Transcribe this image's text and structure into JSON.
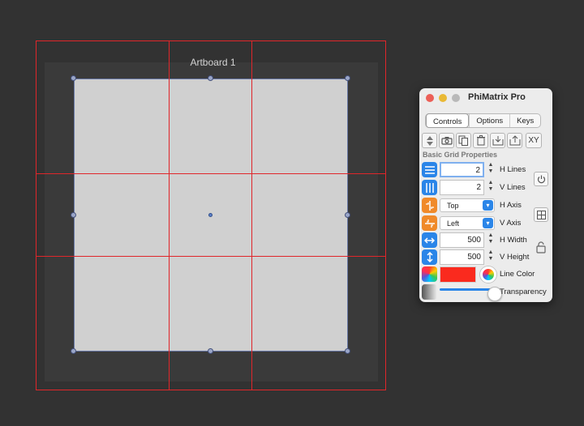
{
  "canvas": {
    "artboard_title": "Artboard 1",
    "grid_color": "#e0262a"
  },
  "panel": {
    "title": "PhiMatrix Pro",
    "tabs": [
      {
        "label": "Controls",
        "active": true
      },
      {
        "label": "Options",
        "active": false
      },
      {
        "label": "Keys",
        "active": false
      }
    ],
    "toolbar": {
      "icons": [
        "sort-icon",
        "camera-icon",
        "copy-icon",
        "trash-icon",
        "import-icon",
        "export-icon"
      ],
      "xy_label": "XY"
    },
    "section_title": "Basic Grid Properties",
    "fields": {
      "h_lines": {
        "value": "2",
        "label": "H Lines"
      },
      "v_lines": {
        "value": "2",
        "label": "V Lines"
      },
      "h_axis": {
        "value": "Top",
        "label": "H Axis"
      },
      "v_axis": {
        "value": "Left",
        "label": "V Axis"
      },
      "h_width": {
        "value": "500",
        "label": "H Width"
      },
      "v_height": {
        "value": "500",
        "label": "V Height"
      },
      "line_color": {
        "value": "#fa2a1e",
        "label": "Line Color"
      },
      "transparency": {
        "label": "Transparency",
        "level": 1.0
      }
    },
    "side_buttons": [
      "power-icon",
      "grid-icon",
      "lock-icon"
    ]
  }
}
